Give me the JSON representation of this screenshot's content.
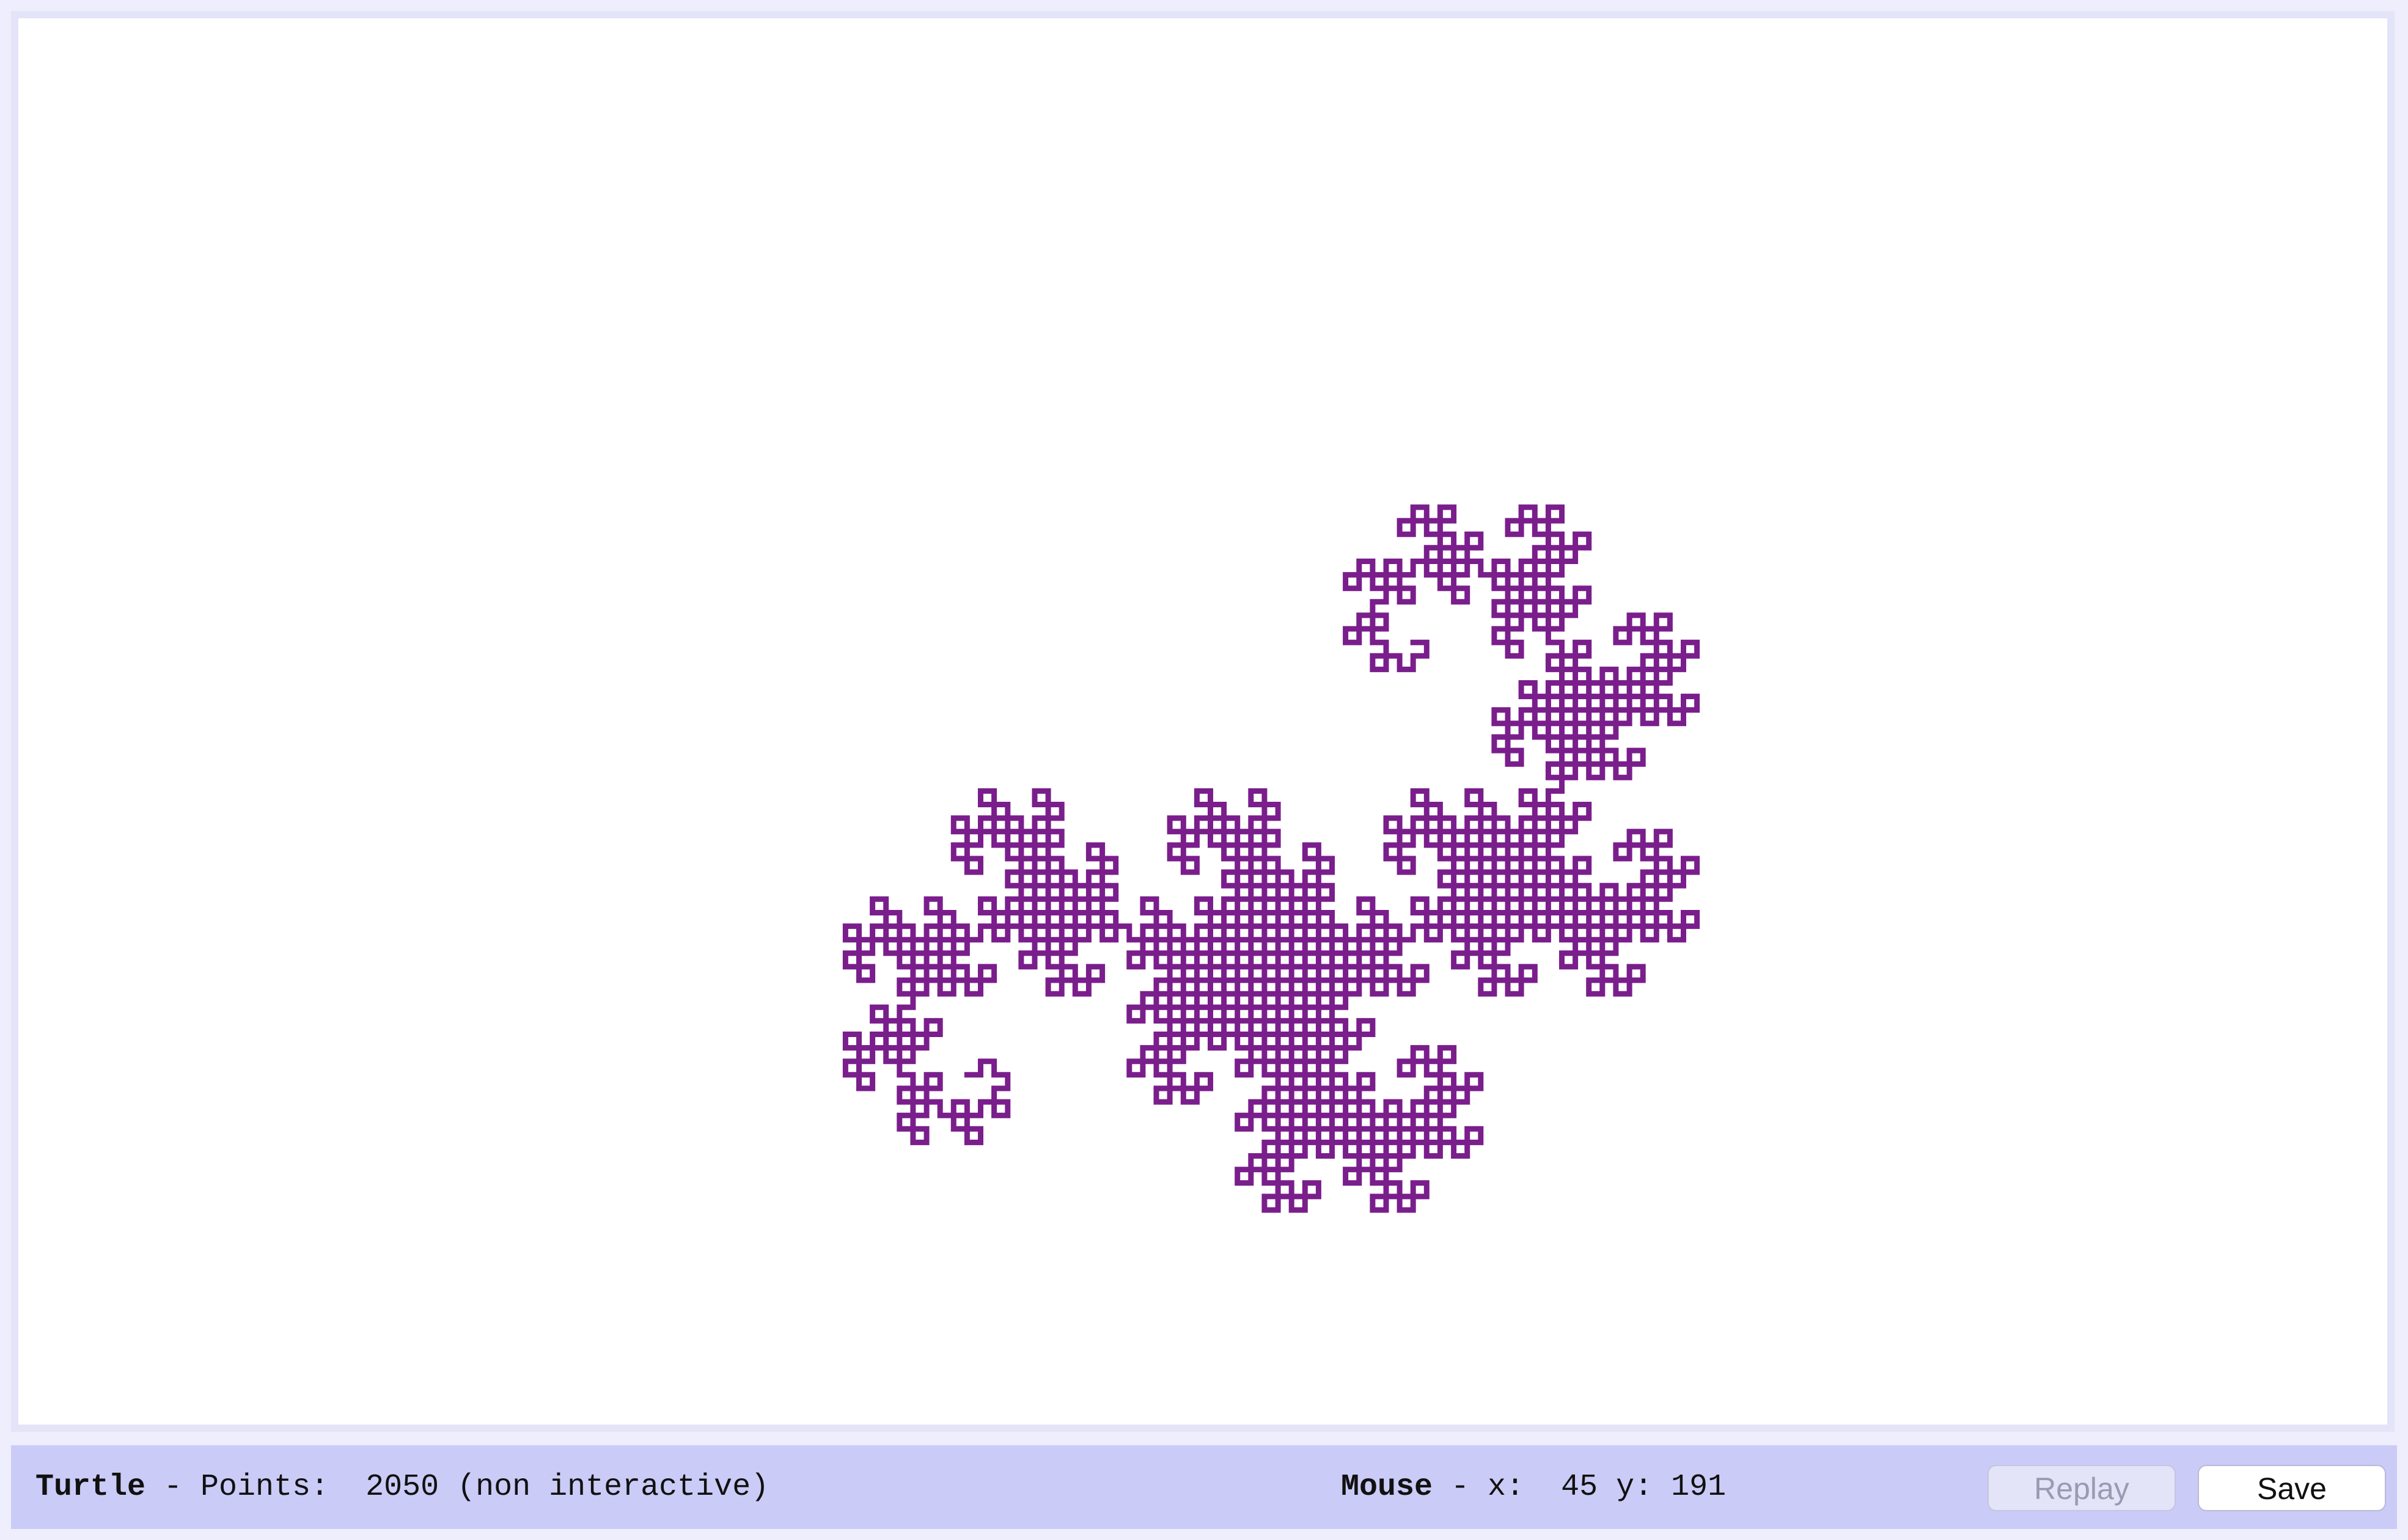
{
  "colors": {
    "stroke": "#7a1e8c",
    "canvas_bg": "#ffffff",
    "statusbar_bg": "#cbcbf7",
    "page_bg": "#eeeefc"
  },
  "status": {
    "turtle_label": "Turtle",
    "points_text": " - Points:  2050 (non interactive)",
    "mouse_label": "Mouse",
    "mouse_text": " - x:  45 y: 191"
  },
  "buttons": {
    "replay_label": "Replay",
    "save_label": "Save"
  },
  "turtle": {
    "curve": "dragon-curve",
    "points": 2050,
    "interactive": false
  }
}
